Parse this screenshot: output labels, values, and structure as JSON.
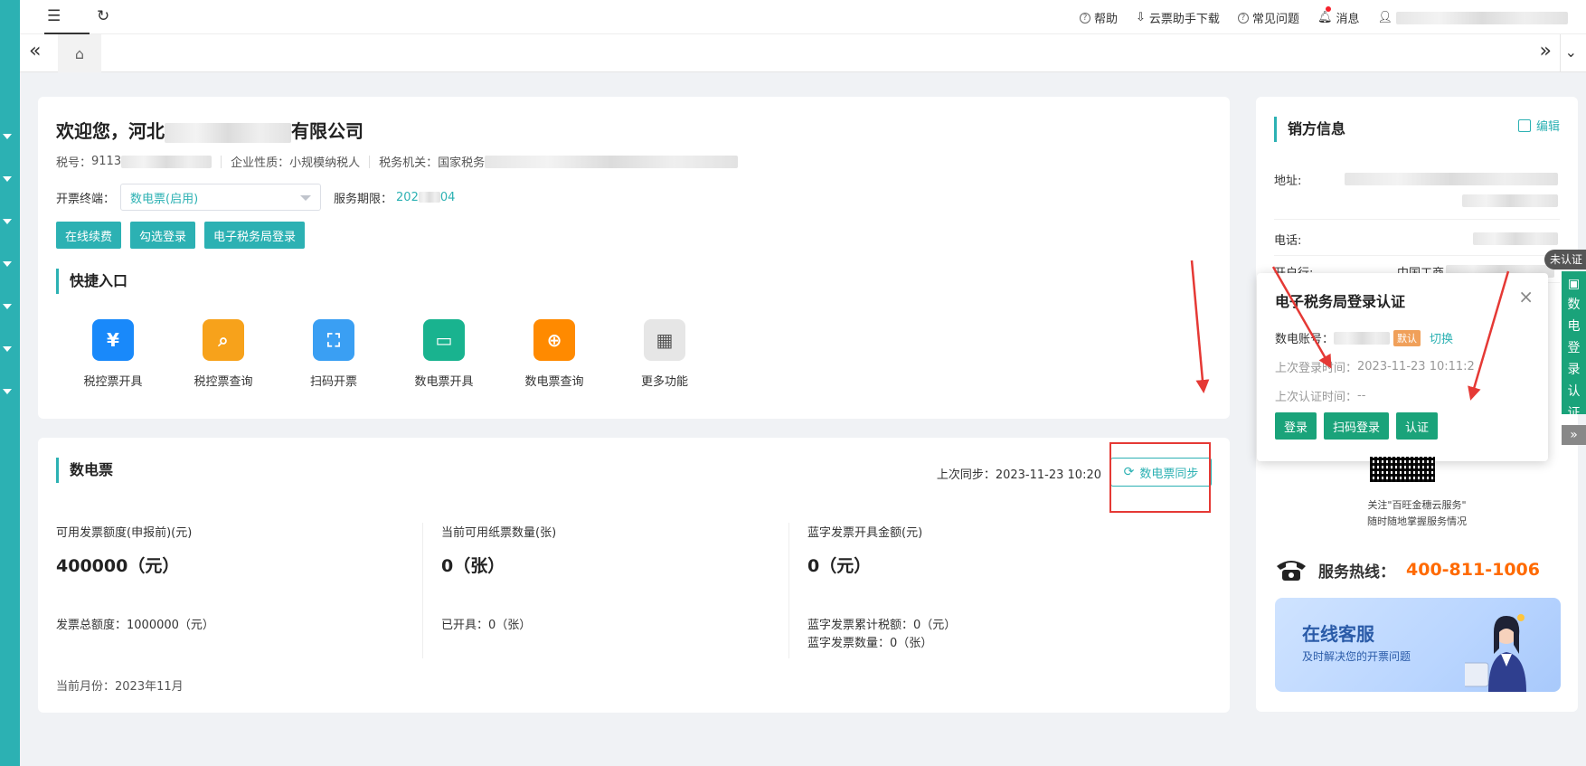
{
  "topbar": {
    "help": "帮助",
    "download": "云票助手下载",
    "faq": "常见问题",
    "messages": "消息"
  },
  "welcome": {
    "greeting_prefix": "欢迎您，河北",
    "company_suffix": "有限公司",
    "tax_label": "税号：",
    "tax_value": "9113",
    "nature_label": "企业性质：",
    "nature_value": "小规模纳税人",
    "authority_label": "税务机关：",
    "authority_value": "国家税务",
    "terminal_label": "开票终端：",
    "terminal_value": "数电票(启用)",
    "service_label": "服务期限：",
    "service_value_a": "202",
    "service_value_b": "04",
    "buttons": [
      "在线续费",
      "勾选登录",
      "电子税务局登录"
    ]
  },
  "quick": {
    "title": "快捷入口",
    "items": [
      {
        "label": "税控票开具",
        "color": "#1989fa",
        "icon": "tax-invoice-issue-icon"
      },
      {
        "label": "税控票查询",
        "color": "#f7a21b",
        "icon": "tax-invoice-query-icon"
      },
      {
        "label": "扫码开票",
        "color": "#3a9ff3",
        "icon": "scan-invoice-icon"
      },
      {
        "label": "数电票开具",
        "color": "#19b38f",
        "icon": "e-invoice-issue-icon"
      },
      {
        "label": "数电票查询",
        "color": "#ff8a00",
        "icon": "e-invoice-query-icon"
      },
      {
        "label": "更多功能",
        "color": "#e6e6e6",
        "icon": "more-functions-icon"
      }
    ]
  },
  "sdp": {
    "title": "数电票",
    "last_sync_label": "上次同步：",
    "last_sync_value": "2023-11-23 10:20",
    "sync_button": "数电票同步",
    "col1": {
      "label": "可用发票额度(申报前)(元)",
      "value": "400000（元）",
      "sub1": "发票总额度：1000000（元）"
    },
    "col2": {
      "label": "当前可用纸票数量(张)",
      "value": "0（张）",
      "sub1": "已开具：0（张）"
    },
    "col3": {
      "label": "蓝字发票开具金额(元)",
      "value": "0（元）",
      "sub1": "蓝字发票累计税额：0（元）",
      "sub2": "蓝字发票数量：0（张）"
    },
    "month": "当前月份：2023年11月"
  },
  "seller": {
    "title": "销方信息",
    "edit": "编辑",
    "address_label": "地址:",
    "phone_label": "电话:",
    "bank_label": "开户行:",
    "bank_value": "中国工商"
  },
  "popup": {
    "title": "电子税务局登录认证",
    "account_label": "数电账号：",
    "default_badge": "默认",
    "switch": "切换",
    "last_login_label": "上次登录时间：",
    "last_login_value": "2023-11-23 10:11:2",
    "last_auth_label": "上次认证时间：",
    "last_auth_value": "--",
    "buttons": [
      "登录",
      "扫码登录",
      "认证"
    ]
  },
  "side": {
    "unverified": "未认证",
    "vertical": [
      "数",
      "电",
      "登",
      "录",
      "认",
      "证"
    ],
    "collapse": "»"
  },
  "follow": {
    "line1": "关注\"百旺金穗云服务\"",
    "line2": "随时随地掌握服务情况"
  },
  "hotline": {
    "label": "服务热线：",
    "number": "400-811-1006"
  },
  "service_banner": {
    "title": "在线客服",
    "subtitle": "及时解决您的开票问题"
  }
}
